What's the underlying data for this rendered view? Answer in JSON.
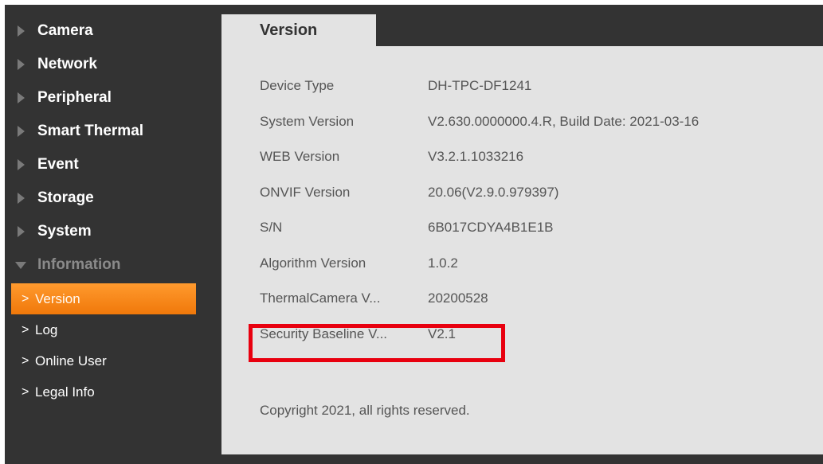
{
  "sidebar": {
    "items": [
      {
        "label": "Camera"
      },
      {
        "label": "Network"
      },
      {
        "label": "Peripheral"
      },
      {
        "label": "Smart Thermal"
      },
      {
        "label": "Event"
      },
      {
        "label": "Storage"
      },
      {
        "label": "System"
      },
      {
        "label": "Information"
      }
    ],
    "sub_items": [
      {
        "label": "Version"
      },
      {
        "label": "Log"
      },
      {
        "label": "Online User"
      },
      {
        "label": "Legal Info"
      }
    ]
  },
  "main": {
    "tab_label": "Version",
    "rows": [
      {
        "label": "Device Type",
        "value": "DH-TPC-DF1241"
      },
      {
        "label": "System Version",
        "value": "V2.630.0000000.4.R, Build Date: 2021-03-16"
      },
      {
        "label": "WEB Version",
        "value": "V3.2.1.1033216"
      },
      {
        "label": "ONVIF Version",
        "value": "20.06(V2.9.0.979397)"
      },
      {
        "label": "S/N",
        "value": "6B017CDYA4B1E1B"
      },
      {
        "label": "Algorithm Version",
        "value": "1.0.2"
      },
      {
        "label": "ThermalCamera V...",
        "value": "20200528"
      },
      {
        "label": "Security Baseline V...",
        "value": "V2.1"
      }
    ],
    "copyright": "Copyright 2021, all rights reserved."
  },
  "colors": {
    "background": "#333333",
    "panel": "#e3e3e3",
    "active": "#f58a1f",
    "highlight": "#e8000f"
  },
  "icons": {
    "collapsed": "triangle-right-icon",
    "expanded": "triangle-down-icon",
    "sub": "chevron-right-icon"
  }
}
